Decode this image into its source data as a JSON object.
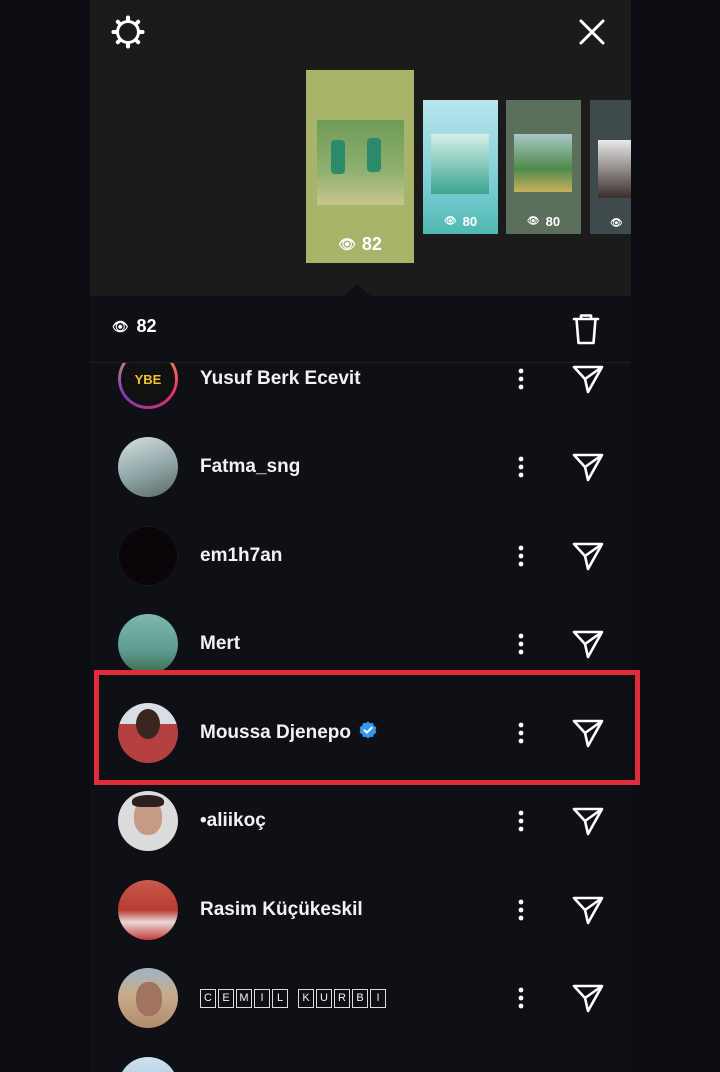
{
  "story_viewer": {
    "settings_icon": "gear-icon",
    "close_icon": "close-icon",
    "stories": [
      {
        "views": "82",
        "selected": true,
        "bg": "#a7b46a"
      },
      {
        "views": "80",
        "selected": false,
        "bg": "#a8dbe6"
      },
      {
        "views": "80",
        "selected": false,
        "bg": "#5b6f5c"
      },
      {
        "views": "",
        "selected": false,
        "bg": "#3f4a4c"
      }
    ]
  },
  "viewers_header": {
    "eye_icon": "eye-icon",
    "count": "82",
    "delete_icon": "trash-icon"
  },
  "viewers": [
    {
      "name": "Yusuf Berk Ecevit",
      "avatar_badge": "YBE",
      "verified": false
    },
    {
      "name": "Fatma_sng",
      "verified": false
    },
    {
      "name": "em1h7an",
      "verified": false
    },
    {
      "name": "Mert",
      "verified": false
    },
    {
      "name": "Moussa Djenepo",
      "verified": true
    },
    {
      "name": "•aliikoç",
      "verified": false
    },
    {
      "name": "Rasim Küçükeskil",
      "verified": false
    },
    {
      "name": "CEMIL KURBI",
      "boxed_letters": [
        "C",
        "E",
        "M",
        "I",
        "L",
        "K",
        "U",
        "R",
        "B",
        "I"
      ],
      "verified": false
    }
  ],
  "colors": {
    "accent_highlight": "#e02d3c",
    "verified_blue": "#3897f0",
    "background": "#0e1015"
  }
}
